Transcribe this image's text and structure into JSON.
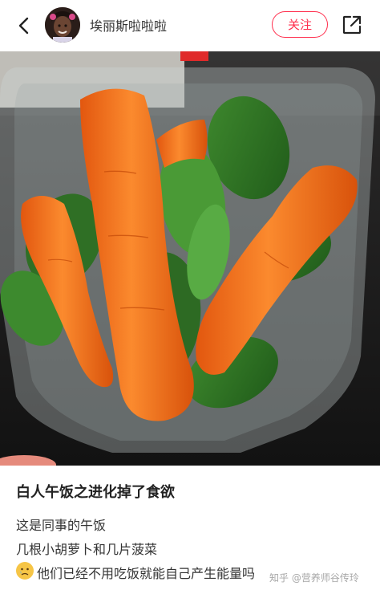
{
  "header": {
    "username": "埃丽斯啦啦啦",
    "follow_label": "关注",
    "back_icon": "chevron-left-icon",
    "share_icon": "share-icon",
    "accent_color": "#ff2e4d"
  },
  "post": {
    "title": "白人午饭之进化掉了食欲",
    "lines": [
      "这是同事的午饭",
      "几根小胡萝卜和几片菠菜",
      "他们已经不用吃饭就能自己产生能量吗"
    ],
    "emoji": "crying-face-emoji",
    "watermark": "知乎 @营养师谷传玲"
  }
}
